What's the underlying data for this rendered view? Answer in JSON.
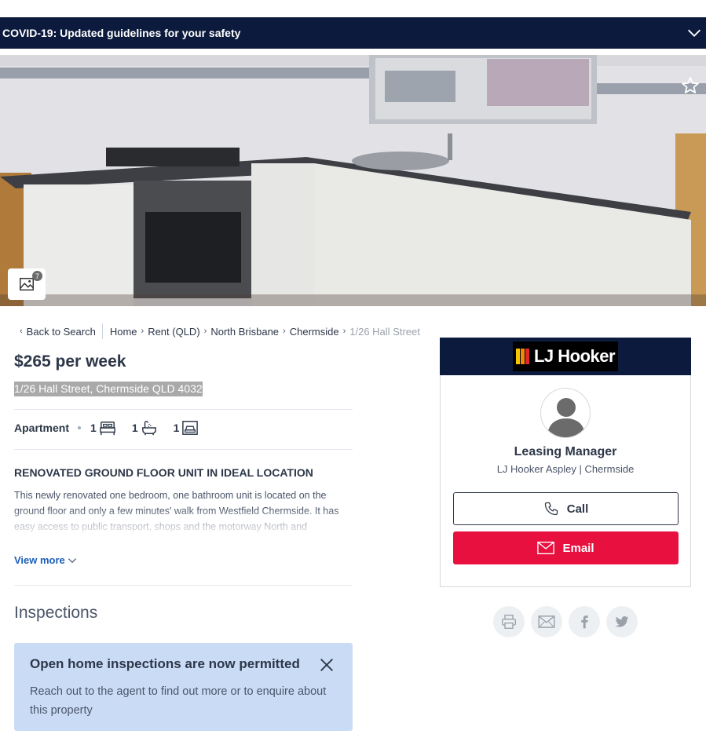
{
  "covid": {
    "title": "COVID-19: Updated guidelines for your safety"
  },
  "gallery": {
    "count": "7"
  },
  "breadcrumb": {
    "back": "Back to Search",
    "items": [
      "Home",
      "Rent (QLD)",
      "North Brisbane",
      "Chermside"
    ],
    "current": "1/26 Hall Street"
  },
  "listing": {
    "price": "$265 per week",
    "address": "1/26 Hall Street, Chermside QLD 4032",
    "property_type": "Apartment",
    "bedrooms": "1",
    "bathrooms": "1",
    "parking": "1",
    "headline": "RENOVATED GROUND FLOOR UNIT IN IDEAL LOCATION",
    "description": "This newly renovated one bedroom, one bathroom unit is located on the ground floor and only a few minutes' walk from Westfield Chermside. It has easy access to public transport, shops and the motorway North and",
    "view_more": "View more"
  },
  "inspections": {
    "title": "Inspections",
    "notice_title": "Open home inspections are now permitted",
    "notice_body": "Reach out to the agent to find out more or to enquire about this property"
  },
  "agent": {
    "brand": "LJ Hooker",
    "name": "Leasing Manager",
    "agency": "LJ Hooker Aspley | Chermside",
    "call_label": "Call",
    "email_label": "Email"
  },
  "colors": {
    "navy": "#0c1b3d",
    "email_red": "#e8103f",
    "notice_blue": "#cadcf5",
    "link_blue": "#1c5fb8",
    "logo_yellow": "#f5c400",
    "logo_orange": "#f28a00",
    "logo_red": "#e3262b"
  },
  "icons": {
    "covid_toggle": "chevron-down-icon",
    "favourite": "star-icon",
    "gallery": "image-gallery-icon",
    "bed": "bed-icon",
    "bath": "bath-icon",
    "car": "car-icon",
    "call": "phone-icon",
    "email": "envelope-icon",
    "share": [
      "printer-icon",
      "envelope-icon",
      "facebook-icon",
      "twitter-icon"
    ]
  }
}
